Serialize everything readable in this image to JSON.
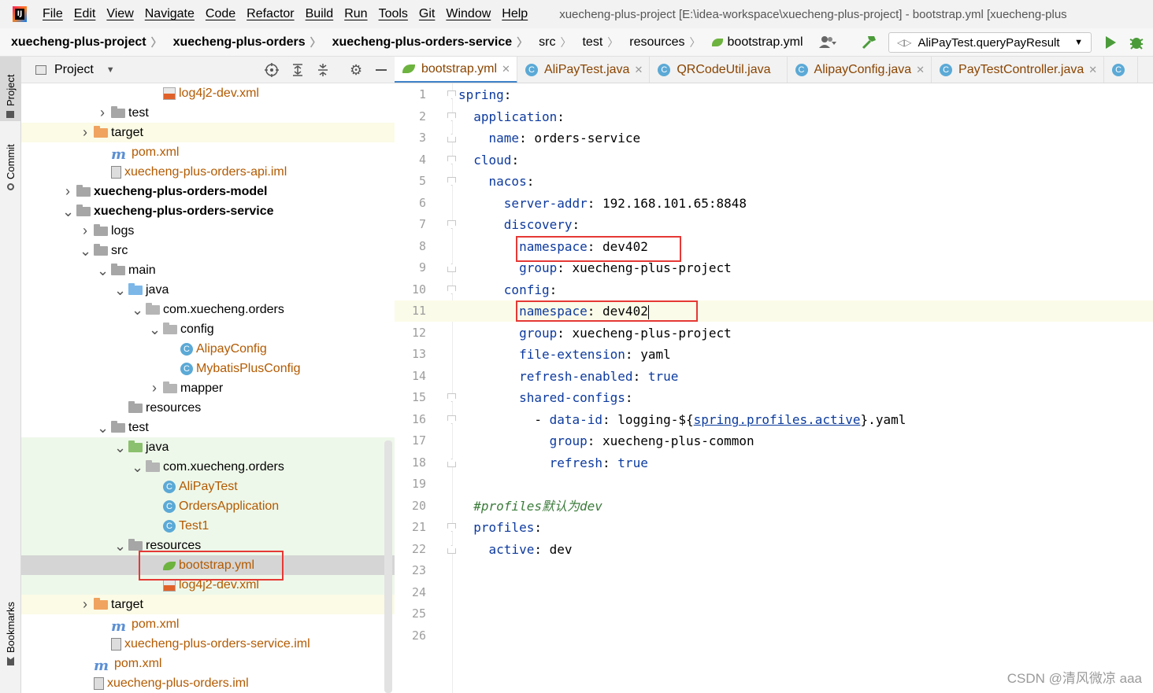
{
  "menu": {
    "items": [
      "File",
      "Edit",
      "View",
      "Navigate",
      "Code",
      "Refactor",
      "Build",
      "Run",
      "Tools",
      "Git",
      "Window",
      "Help"
    ],
    "window_title": "xuecheng-plus-project [E:\\idea-workspace\\xuecheng-plus-project] - bootstrap.yml [xuecheng-plus"
  },
  "nav": {
    "crumbs": [
      "xuecheng-plus-project",
      "xuecheng-plus-orders",
      "xuecheng-plus-orders-service",
      "src",
      "test",
      "resources",
      "bootstrap.yml"
    ],
    "run_config": "AliPayTest.queryPayResult"
  },
  "stripe": {
    "project": "Project",
    "commit": "Commit",
    "bookmarks": "Bookmarks"
  },
  "project_panel": {
    "title": "Project"
  },
  "tree": [
    {
      "label": "log4j2-dev.xml",
      "depth": 7,
      "icon": "xml",
      "arrow": "",
      "style": "orange",
      "bg": ""
    },
    {
      "label": "test",
      "depth": 4,
      "icon": "folder",
      "arrow": ">",
      "style": "",
      "bg": ""
    },
    {
      "label": "target",
      "depth": 3,
      "icon": "folder-orange",
      "arrow": ">",
      "style": "",
      "bg": "yellow"
    },
    {
      "label": "pom.xml",
      "depth": 4,
      "icon": "maven",
      "arrow": "",
      "style": "orange",
      "bg": ""
    },
    {
      "label": "xuecheng-plus-orders-api.iml",
      "depth": 4,
      "icon": "iml",
      "arrow": "",
      "style": "orange",
      "bg": ""
    },
    {
      "label": "xuecheng-plus-orders-model",
      "depth": 2,
      "icon": "module",
      "arrow": ">",
      "style": "bold",
      "bg": ""
    },
    {
      "label": "xuecheng-plus-orders-service",
      "depth": 2,
      "icon": "module",
      "arrow": "v",
      "style": "bold",
      "bg": ""
    },
    {
      "label": "logs",
      "depth": 3,
      "icon": "folder",
      "arrow": ">",
      "style": "",
      "bg": ""
    },
    {
      "label": "src",
      "depth": 3,
      "icon": "folder",
      "arrow": "v",
      "style": "",
      "bg": ""
    },
    {
      "label": "main",
      "depth": 4,
      "icon": "folder",
      "arrow": "v",
      "style": "",
      "bg": ""
    },
    {
      "label": "java",
      "depth": 5,
      "icon": "folder-blue",
      "arrow": "v",
      "style": "",
      "bg": ""
    },
    {
      "label": "com.xuecheng.orders",
      "depth": 6,
      "icon": "package",
      "arrow": "v",
      "style": "",
      "bg": ""
    },
    {
      "label": "config",
      "depth": 7,
      "icon": "package",
      "arrow": "v",
      "style": "",
      "bg": ""
    },
    {
      "label": "AlipayConfig",
      "depth": 8,
      "icon": "class",
      "arrow": "",
      "style": "orange",
      "bg": ""
    },
    {
      "label": "MybatisPlusConfig",
      "depth": 8,
      "icon": "class",
      "arrow": "",
      "style": "orange",
      "bg": ""
    },
    {
      "label": "mapper",
      "depth": 7,
      "icon": "package",
      "arrow": ">",
      "style": "",
      "bg": ""
    },
    {
      "label": "resources",
      "depth": 5,
      "icon": "folder-res",
      "arrow": "",
      "style": "",
      "bg": ""
    },
    {
      "label": "test",
      "depth": 4,
      "icon": "folder",
      "arrow": "v",
      "style": "",
      "bg": ""
    },
    {
      "label": "java",
      "depth": 5,
      "icon": "folder-green",
      "arrow": "v",
      "style": "",
      "bg": "green"
    },
    {
      "label": "com.xuecheng.orders",
      "depth": 6,
      "icon": "package",
      "arrow": "v",
      "style": "",
      "bg": "green"
    },
    {
      "label": "AliPayTest",
      "depth": 7,
      "icon": "class-test",
      "arrow": "",
      "style": "orange",
      "bg": "green"
    },
    {
      "label": "OrdersApplication",
      "depth": 7,
      "icon": "class-test",
      "arrow": "",
      "style": "orange",
      "bg": "green"
    },
    {
      "label": "Test1",
      "depth": 7,
      "icon": "class-test",
      "arrow": "",
      "style": "orange",
      "bg": "green"
    },
    {
      "label": "resources",
      "depth": 5,
      "icon": "folder-res",
      "arrow": "v",
      "style": "",
      "bg": "green"
    },
    {
      "label": "bootstrap.yml",
      "depth": 7,
      "icon": "yml",
      "arrow": "",
      "style": "orange",
      "bg": "sel"
    },
    {
      "label": "log4j2-dev.xml",
      "depth": 7,
      "icon": "xml",
      "arrow": "",
      "style": "orange",
      "bg": "green"
    },
    {
      "label": "target",
      "depth": 3,
      "icon": "folder-orange",
      "arrow": ">",
      "style": "",
      "bg": "yellow"
    },
    {
      "label": "pom.xml",
      "depth": 4,
      "icon": "maven",
      "arrow": "",
      "style": "orange",
      "bg": ""
    },
    {
      "label": "xuecheng-plus-orders-service.iml",
      "depth": 4,
      "icon": "iml",
      "arrow": "",
      "style": "orange",
      "bg": ""
    },
    {
      "label": "pom.xml",
      "depth": 3,
      "icon": "maven",
      "arrow": "",
      "style": "orange",
      "bg": ""
    },
    {
      "label": "xuecheng-plus-orders.iml",
      "depth": 3,
      "icon": "iml",
      "arrow": "",
      "style": "orange",
      "bg": ""
    }
  ],
  "tabs": [
    {
      "label": "bootstrap.yml",
      "icon": "yml",
      "active": true,
      "close": true
    },
    {
      "label": "AliPayTest.java",
      "icon": "class",
      "active": false,
      "close": true
    },
    {
      "label": "QRCodeUtil.java",
      "icon": "class",
      "active": false,
      "close": false
    },
    {
      "label": "AlipayConfig.java",
      "icon": "class",
      "active": false,
      "close": true
    },
    {
      "label": "PayTestController.java",
      "icon": "class",
      "active": false,
      "close": true
    }
  ],
  "code_lines": [
    [
      [
        "k",
        "spring"
      ],
      [
        "v",
        ":"
      ]
    ],
    [
      [
        "v",
        "  "
      ],
      [
        "k",
        "application"
      ],
      [
        "v",
        ":"
      ]
    ],
    [
      [
        "v",
        "    "
      ],
      [
        "k",
        "name"
      ],
      [
        "v",
        ": orders-service"
      ]
    ],
    [
      [
        "v",
        "  "
      ],
      [
        "k",
        "cloud"
      ],
      [
        "v",
        ":"
      ]
    ],
    [
      [
        "v",
        "    "
      ],
      [
        "k",
        "nacos"
      ],
      [
        "v",
        ":"
      ]
    ],
    [
      [
        "v",
        "      "
      ],
      [
        "k",
        "server-addr"
      ],
      [
        "v",
        ": 192.168.101.65:8848"
      ]
    ],
    [
      [
        "v",
        "      "
      ],
      [
        "k",
        "discovery"
      ],
      [
        "v",
        ":"
      ]
    ],
    [
      [
        "v",
        "        "
      ],
      [
        "k",
        "namespace"
      ],
      [
        "v",
        ": dev402"
      ]
    ],
    [
      [
        "v",
        "        "
      ],
      [
        "k",
        "group"
      ],
      [
        "v",
        ": xuecheng-plus-project"
      ]
    ],
    [
      [
        "v",
        "      "
      ],
      [
        "k",
        "config"
      ],
      [
        "v",
        ":"
      ]
    ],
    [
      [
        "v",
        "        "
      ],
      [
        "k",
        "namespace"
      ],
      [
        "v",
        ": dev402"
      ]
    ],
    [
      [
        "v",
        "        "
      ],
      [
        "k",
        "group"
      ],
      [
        "v",
        ": xuecheng-plus-project"
      ]
    ],
    [
      [
        "v",
        "        "
      ],
      [
        "k",
        "file-extension"
      ],
      [
        "v",
        ": yaml"
      ]
    ],
    [
      [
        "v",
        "        "
      ],
      [
        "k",
        "refresh-enabled"
      ],
      [
        "v",
        ": "
      ],
      [
        "t",
        "true"
      ]
    ],
    [
      [
        "v",
        "        "
      ],
      [
        "k",
        "shared-configs"
      ],
      [
        "v",
        ":"
      ]
    ],
    [
      [
        "v",
        "          - "
      ],
      [
        "k",
        "data-id"
      ],
      [
        "v",
        ": logging-${"
      ],
      [
        "lnk",
        "spring.profiles.active"
      ],
      [
        "v",
        "}.yaml"
      ]
    ],
    [
      [
        "v",
        "            "
      ],
      [
        "k",
        "group"
      ],
      [
        "v",
        ": xuecheng-plus-common"
      ]
    ],
    [
      [
        "v",
        "            "
      ],
      [
        "k",
        "refresh"
      ],
      [
        "v",
        ": "
      ],
      [
        "t",
        "true"
      ]
    ],
    [],
    [
      [
        "v",
        "  "
      ],
      [
        "cm",
        "#profiles默认为dev"
      ]
    ],
    [
      [
        "v",
        "  "
      ],
      [
        "k",
        "profiles"
      ],
      [
        "v",
        ":"
      ]
    ],
    [
      [
        "v",
        "    "
      ],
      [
        "k",
        "active"
      ],
      [
        "v",
        ": dev"
      ]
    ],
    [],
    [],
    [],
    []
  ],
  "current_line": 11,
  "watermark": "CSDN @清风微凉 aaa",
  "colors": {
    "accent": "#4083c9",
    "highlight_box": "#e53935"
  }
}
